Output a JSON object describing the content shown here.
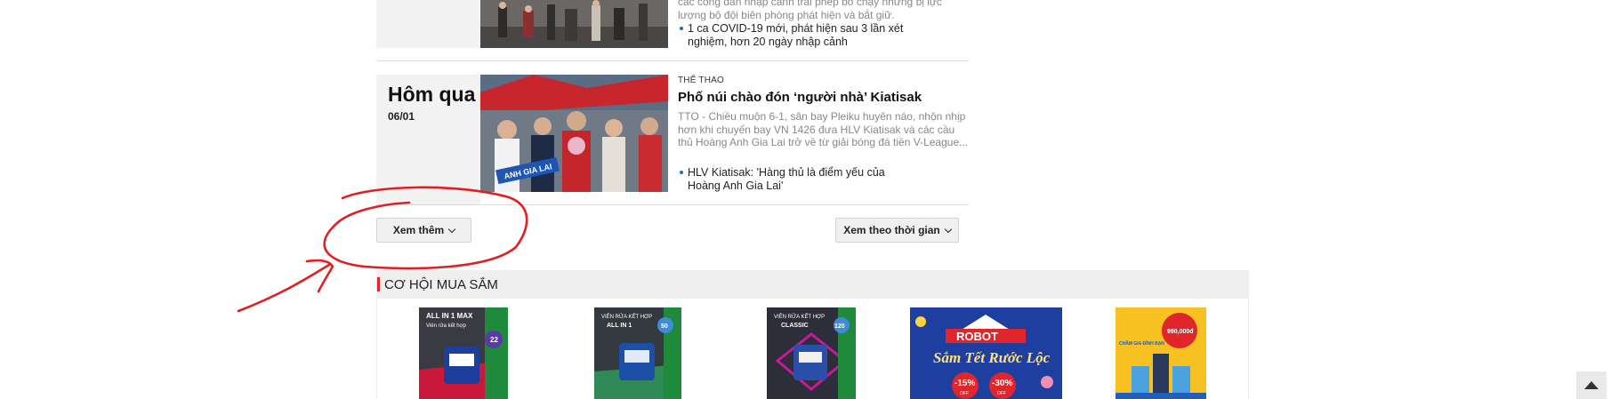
{
  "article_prev": {
    "sapo_line1": "các công dân nhập cảnh trái phép bỏ chạy nhưng bị lực",
    "sapo_line2": "lượng bộ đội biên phòng phát hiện và bắt giữ.",
    "related": "1 ca COVID-19 mới, phát hiện sau 3 lần xét nghiệm, hơn 20 ngày nhập cảnh"
  },
  "article_main": {
    "day_label": "Hôm qua",
    "date": "06/01",
    "category": "THỂ THAO",
    "title": "Phố núi chào đón ‘người nhà’ Kiatisak",
    "sapo": "TTO - Chiều muộn 6-1, sân bay Pleiku huyên náo, nhộn nhịp hơn khi chuyến bay VN 1426 đưa HLV Kiatisak và các cầu thủ Hoàng Anh Gia Lai trở về từ giải bóng đá tiền V-League...",
    "related": "HLV Kiatisak: 'Hàng thủ là điểm yếu của Hoàng Anh Gia Lai'",
    "banner_text": "ANH GIA LAI"
  },
  "buttons": {
    "more": "Xem thêm",
    "by_time": "Xem theo thời gian"
  },
  "shopping": {
    "title": "CƠ HỘI MUA SẮM",
    "products": [
      {
        "line1": "ALL IN 1 MAX",
        "line2": "Viên rửa kết hợp",
        "badge": "22"
      },
      {
        "line1": "VIÊN RỬA KẾT HỢP",
        "line2": "ALL IN 1",
        "badge": "50"
      },
      {
        "line1": "VIÊN RỬA KẾT HỢP",
        "line2": "CLASSIC",
        "badge": "120"
      },
      {
        "brand": "ROBOT",
        "tagline": "Sắm Tết Rước Lộc",
        "off1": "-15%",
        "off2": "-30%",
        "off_label": "OFF"
      },
      {
        "price": "990,000đ",
        "note": "CHĂM GIA ĐÌNH BẠN"
      }
    ]
  },
  "colors": {
    "accent_red": "#e0262b",
    "link_dot": "#1a6fbd",
    "annotation_red": "#e02020",
    "robot_blue": "#1f3fa0"
  },
  "icons": {
    "more_chevron": "chevron-down-icon",
    "time_chevron": "chevron-down-icon",
    "scroll_top": "caret-up-icon"
  }
}
